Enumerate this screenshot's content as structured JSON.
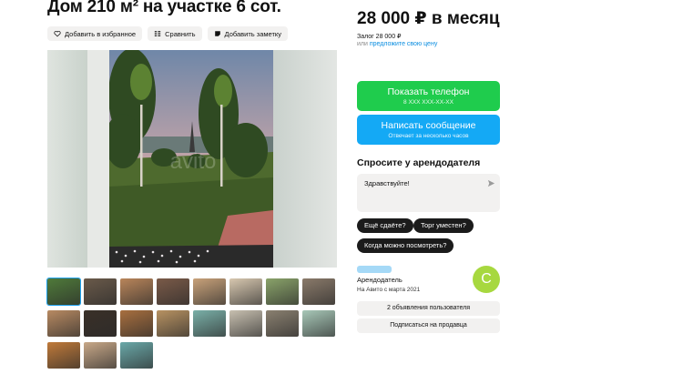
{
  "listing": {
    "title": "Дом 210 м² на участке 6 сот.",
    "actions": {
      "favorite": "Добавить в избранное",
      "compare": "Сравнить",
      "note": "Добавить заметку"
    }
  },
  "pricing": {
    "price": "28 000 ₽ в месяц",
    "deposit": "Залог 28 000 ₽",
    "offer_prefix": "или",
    "offer_link": "предложите свою цену"
  },
  "contact": {
    "phone_label": "Показать телефон",
    "phone_masked": "8 XXX XXX-XX-XX",
    "message_label": "Написать сообщение",
    "message_sub": "Отвечает за несколько часов"
  },
  "ask": {
    "title": "Спросите у арендодателя",
    "message_value": "Здравствуйте!",
    "quick_questions": [
      "Ещё сдаёте?",
      "Торг уместен?",
      "Когда можно посмотреть?"
    ]
  },
  "seller": {
    "role": "Арендодатель",
    "since": "На Авито с марта 2021",
    "avatar_letter": "C",
    "listings_button": "2 объявления пользователя",
    "subscribe_button": "Подписаться на продавца"
  },
  "gallery": {
    "watermark": "avito",
    "thumb_colors": [
      [
        "#4f7a3a",
        "#6a5a4a",
        "#b9855a",
        "#7a5a48",
        "#c9a27a",
        "#d8c8b0",
        "#8aa36a",
        "#8a7a6a"
      ],
      [
        "#b88a62",
        "#3a3028",
        "#a86f3f",
        "#b89262",
        "#7ab0a8",
        "#c8c0b0",
        "#8a8070",
        "#a8c8b8"
      ],
      [
        "#c07a3a",
        "#c8a888",
        "#6aa8a8"
      ]
    ]
  }
}
